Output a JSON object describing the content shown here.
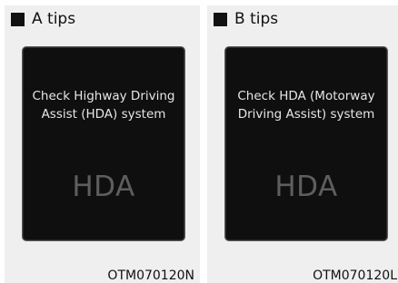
{
  "panels": [
    {
      "title": "A tips",
      "message_line1": "Check Highway Driving",
      "message_line2": "Assist (HDA) system",
      "indicator": "HDA",
      "code": "OTM070120N"
    },
    {
      "title": "B tips",
      "message_line1": "Check HDA (Motorway",
      "message_line2": "Driving Assist) system",
      "indicator": "HDA",
      "code": "OTM070120L"
    }
  ],
  "colors": {
    "panel_background": "#efefef",
    "screen_background": "#0f0f0f",
    "message_text": "#e6e6e6",
    "indicator_text": "#5e5e5e"
  },
  "icons": {
    "bullet": "black-square-icon"
  }
}
